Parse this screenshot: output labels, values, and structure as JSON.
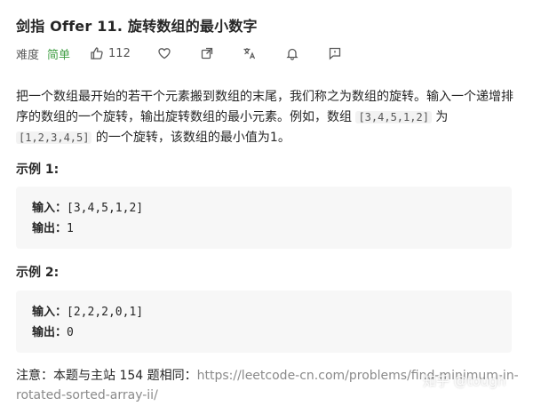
{
  "problem": {
    "title": "剑指 Offer 11. 旋转数组的最小数字",
    "difficulty_label": "难度",
    "difficulty_value": "简单",
    "likes": "112"
  },
  "description": {
    "part1": "把一个数组最开始的若干个元素搬到数组的末尾，我们称之为数组的旋转。输入一个递增排序的数组的一个旋转，输出旋转数组的最小元素。例如，数组 ",
    "code1": "[3,4,5,1,2]",
    "part2": " 为 ",
    "code2": "[1,2,3,4,5]",
    "part3": " 的一个旋转，该数组的最小值为1。"
  },
  "examples": [
    {
      "title": "示例 1:",
      "input_label": "输入：",
      "input": "[3,4,5,1,2]",
      "output_label": "输出：",
      "output": "1"
    },
    {
      "title": "示例 2:",
      "input_label": "输入：",
      "input": "[2,2,2,0,1]",
      "output_label": "输出：",
      "output": "0"
    }
  ],
  "note": {
    "text": "注意：本题与主站 154 题相同：",
    "link": "https://leetcode-cn.com/problems/find-minimum-in-rotated-sorted-array-ii/"
  },
  "watermark": "知乎 @tough",
  "colors": {
    "difficulty_easy": "#43a047",
    "code_bg": "#f7f7f7",
    "link": "#8a8a8a"
  },
  "icons": [
    "thumbs-up-icon",
    "heart-icon",
    "share-icon",
    "translate-icon",
    "bell-icon",
    "feedback-icon"
  ]
}
